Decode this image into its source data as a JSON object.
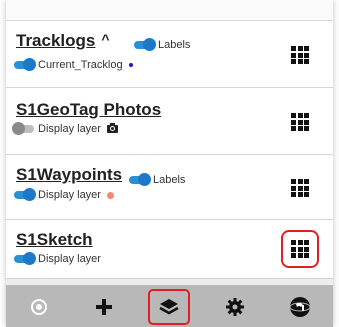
{
  "layers": [
    {
      "title": "Tracklogs",
      "has_chevron": true,
      "chevron": "^",
      "inline_label": "Labels",
      "sub_label": "Current_Tracklog",
      "sub_marker": "blue-dot"
    },
    {
      "title": "S1GeoTag Photos",
      "sub_label": "Display layer",
      "sub_marker": "camera-icon"
    },
    {
      "title": "S1Waypoints",
      "inline_label": "Labels",
      "sub_label": "Display layer",
      "sub_marker": "salmon-dot"
    },
    {
      "title": "S1Sketch",
      "sub_label": "Display layer"
    }
  ],
  "toolbar": {
    "items": [
      "gps-target-icon",
      "add-icon",
      "layers-icon",
      "settings-icon",
      "s1-globe-icon"
    ],
    "active": "layers-icon"
  },
  "colors": {
    "accent": "#1e78c8",
    "toolbar": "#b8b8b8",
    "highlight": "#e02020"
  }
}
